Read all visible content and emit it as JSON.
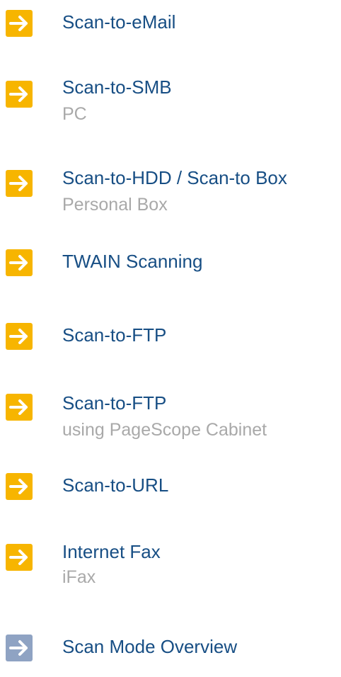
{
  "menu": {
    "items": [
      {
        "label": "Scan-to-eMail",
        "sublabel": "",
        "icon": "arrow-right-icon",
        "accent": "#f7b500"
      },
      {
        "label": "Scan-to-SMB",
        "sublabel": "PC",
        "icon": "arrow-right-icon",
        "accent": "#f7b500"
      },
      {
        "label": "Scan-to-HDD / Scan-to Box",
        "sublabel": "Personal Box",
        "icon": "arrow-right-icon",
        "accent": "#f7b500"
      },
      {
        "label": "TWAIN Scanning",
        "sublabel": "",
        "icon": "arrow-right-icon",
        "accent": "#f7b500"
      },
      {
        "label": "Scan-to-FTP",
        "sublabel": "",
        "icon": "arrow-right-icon",
        "accent": "#f7b500"
      },
      {
        "label": "Scan-to-FTP",
        "sublabel": "using PageScope Cabinet",
        "icon": "arrow-right-icon",
        "accent": "#f7b500"
      },
      {
        "label": "Scan-to-URL",
        "sublabel": "",
        "icon": "arrow-right-icon",
        "accent": "#f7b500"
      },
      {
        "label": "Internet Fax",
        "sublabel": "iFax",
        "icon": "arrow-right-icon",
        "accent": "#f7b500"
      },
      {
        "label": "Scan Mode Overview",
        "sublabel": "",
        "icon": "arrow-right-icon",
        "accent": "#8fa3c3"
      }
    ]
  },
  "colors": {
    "label": "#174e84",
    "sublabel": "#a9a9a9",
    "arrow_bg_yellow": "#f7b500",
    "arrow_bg_blue": "#8fa3c3"
  }
}
